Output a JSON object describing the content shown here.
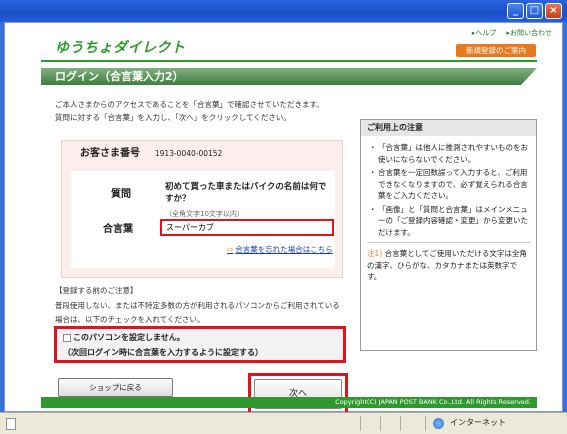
{
  "header": {
    "links": [
      "▸ヘルプ",
      "▸お問い合わせ"
    ],
    "logo": "ゆうちょダイレクト",
    "register": "新規登録のご案内",
    "title": "ログイン（合言葉入力2）"
  },
  "intro": {
    "line1": "ご本人さまからのアクセスであることを「合言葉」で確認させていただきます。",
    "line2": "質問に対する「合言葉」を入力し、「次へ」をクリックしてください。"
  },
  "form": {
    "customer_label": "お客さま番号",
    "customer_number": "1913-0040-00152",
    "question_label": "質問",
    "question_text": "初めて買った車またはバイクの名前は何ですか？",
    "hint": "（全角文字10文字以内）",
    "answer_label": "合言葉",
    "answer_value": "スーパーカブ",
    "forgot_link": "合言葉を忘れた場合はこちら"
  },
  "notice": {
    "title": "【登録する前のご注意】",
    "text": "普段使用しない、または不特定多数の方が利用されるパソコンからご利用されている場合は、以下のチェックを入れてください。",
    "checkbox_line1": "このパソコンを設定しません。",
    "checkbox_line2": "（次回ログイン時に合言葉を入力するように設定する）"
  },
  "buttons": {
    "back": "ショップに戻る",
    "next": "次へ"
  },
  "side": {
    "title": "ご利用上の注意",
    "items": [
      "「合言葉」は他人に推測されやすいものをお使いにならないでください。",
      "合言葉を一定回数誤って入力すると、ご利用できなくなりますので、必ず覚えられる合言葉をご入力ください。",
      "「画像」と「質問と合言葉」はメインメニューの「ご登録内容確認・変更」から変更いただけます。"
    ],
    "note_mark": "注1)",
    "note": "合言葉としてご使用いただける文字は全角の漢字、ひらがな、カタカナまたは英数字です。"
  },
  "footer": "Copyright(C) JAPAN POST BANK Co.,Ltd. All Rights Reserved.",
  "statusbar": {
    "zone": "インターネット"
  },
  "colors": {
    "brand_green": "#2e9a2e",
    "accent_orange": "#e8791e",
    "highlight_red": "#e0141c"
  }
}
